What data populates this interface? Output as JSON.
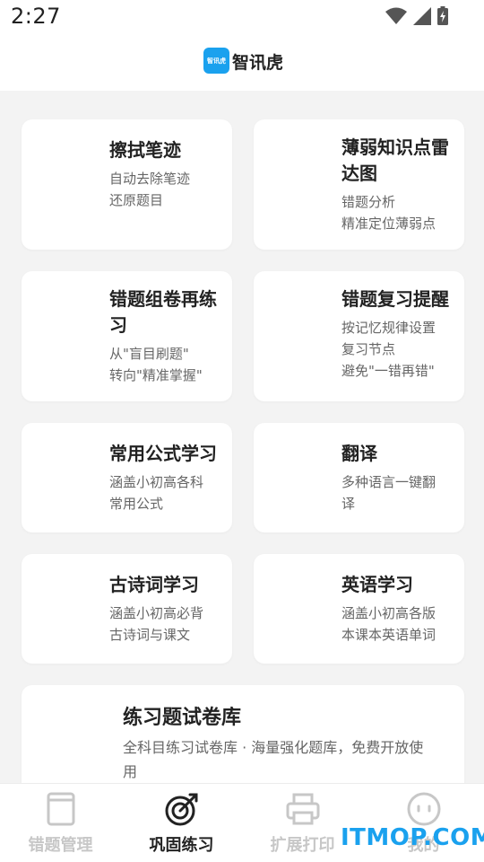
{
  "status_bar": {
    "time": "2:27"
  },
  "header": {
    "logo_text": "智讯虎",
    "title": "智讯虎"
  },
  "cards": [
    {
      "title": "擦拭笔迹",
      "desc": [
        "自动去除笔迹",
        "还原题目"
      ]
    },
    {
      "title": "薄弱知识点雷达图",
      "desc": [
        "错题分析",
        "精准定位薄弱点"
      ]
    },
    {
      "title": "错题组卷再练习",
      "desc": [
        "从\"盲目刷题\"",
        "转向\"精准掌握\""
      ]
    },
    {
      "title": "错题复习提醒",
      "desc": [
        "按记忆规律设置",
        "复习节点",
        "避免\"一错再错\""
      ]
    },
    {
      "title": "常用公式学习",
      "desc": [
        "涵盖小初高各科",
        "常用公式"
      ]
    },
    {
      "title": "翻译",
      "desc": [
        "多种语言一键翻",
        "译"
      ]
    },
    {
      "title": "古诗词学习",
      "desc": [
        "涵盖小初高必背",
        "古诗词与课文"
      ]
    },
    {
      "title": "英语学习",
      "desc": [
        "涵盖小初高各版",
        "本课本英语单词"
      ]
    },
    {
      "title": "练习题试卷库",
      "desc": [
        "全科目练习试卷库 · 海量强化题库，免费开放使",
        "用"
      ]
    }
  ],
  "bottom_nav": [
    {
      "label": "错题管理",
      "icon": "book-icon",
      "active": false
    },
    {
      "label": "巩固练习",
      "icon": "target-icon",
      "active": true
    },
    {
      "label": "扩展打印",
      "icon": "printer-icon",
      "active": false
    },
    {
      "label": "我的",
      "icon": "face-icon",
      "active": false
    }
  ],
  "watermark": "ITMOP.COM",
  "colors": {
    "accent": "#1aa1ee",
    "active_text": "#222222",
    "inactive_text": "#c7c7c7",
    "background": "#f3f3f3"
  }
}
